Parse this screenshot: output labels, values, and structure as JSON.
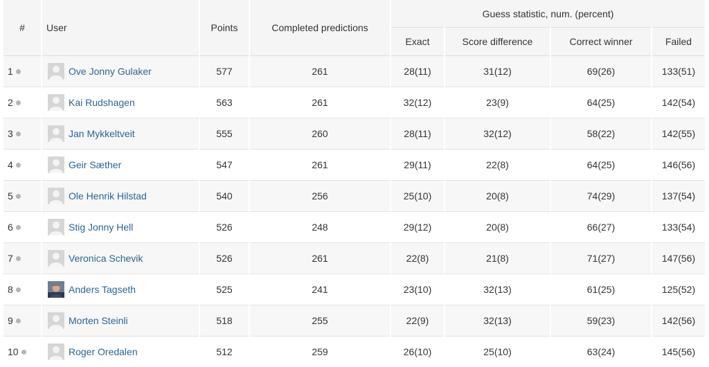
{
  "header": {
    "rank": "#",
    "user": "User",
    "points": "Points",
    "completed": "Completed predictions",
    "group": "Guess statistic, num. (percent)",
    "exact": "Exact",
    "score_difference": "Score difference",
    "correct_winner": "Correct winner",
    "failed": "Failed"
  },
  "colors": {
    "link": "#2a6496",
    "row_alt": "#f7f7f7",
    "header_bg": "#f5f5f5",
    "dot": "#b5b5b5"
  },
  "rows": [
    {
      "rank": "1",
      "avatar": "default-avatar-icon",
      "name": "Ove Jonny Gulaker",
      "points": "577",
      "completed": "261",
      "exact": "28(11)",
      "score_difference": "31(12)",
      "correct_winner": "69(26)",
      "failed": "133(51)"
    },
    {
      "rank": "2",
      "avatar": "default-avatar-icon",
      "name": "Kai Rudshagen",
      "points": "563",
      "completed": "261",
      "exact": "32(12)",
      "score_difference": "23(9)",
      "correct_winner": "64(25)",
      "failed": "142(54)"
    },
    {
      "rank": "3",
      "avatar": "default-avatar-icon",
      "name": "Jan Mykkeltveit",
      "points": "555",
      "completed": "260",
      "exact": "28(11)",
      "score_difference": "32(12)",
      "correct_winner": "58(22)",
      "failed": "142(55)"
    },
    {
      "rank": "4",
      "avatar": "default-avatar-icon",
      "name": "Geir Sæther",
      "points": "547",
      "completed": "261",
      "exact": "29(11)",
      "score_difference": "22(8)",
      "correct_winner": "64(25)",
      "failed": "146(56)"
    },
    {
      "rank": "5",
      "avatar": "default-avatar-icon",
      "name": "Ole Henrik Hilstad",
      "points": "540",
      "completed": "256",
      "exact": "25(10)",
      "score_difference": "20(8)",
      "correct_winner": "74(29)",
      "failed": "137(54)"
    },
    {
      "rank": "6",
      "avatar": "default-avatar-icon",
      "name": "Stig Jonny Hell",
      "points": "526",
      "completed": "248",
      "exact": "29(12)",
      "score_difference": "20(8)",
      "correct_winner": "66(27)",
      "failed": "133(54)"
    },
    {
      "rank": "7",
      "avatar": "default-avatar-icon",
      "name": "Veronica Schevik",
      "points": "526",
      "completed": "261",
      "exact": "22(8)",
      "score_difference": "21(8)",
      "correct_winner": "71(27)",
      "failed": "147(56)"
    },
    {
      "rank": "8",
      "avatar": "photo-avatar-icon",
      "name": "Anders Tagseth",
      "points": "525",
      "completed": "241",
      "exact": "23(10)",
      "score_difference": "32(13)",
      "correct_winner": "61(25)",
      "failed": "125(52)"
    },
    {
      "rank": "9",
      "avatar": "default-avatar-icon",
      "name": "Morten Steinli",
      "points": "518",
      "completed": "255",
      "exact": "22(9)",
      "score_difference": "32(13)",
      "correct_winner": "59(23)",
      "failed": "142(56)"
    },
    {
      "rank": "10",
      "avatar": "default-avatar-icon",
      "name": "Roger Oredalen",
      "points": "512",
      "completed": "259",
      "exact": "26(10)",
      "score_difference": "25(10)",
      "correct_winner": "63(24)",
      "failed": "145(56)"
    }
  ]
}
